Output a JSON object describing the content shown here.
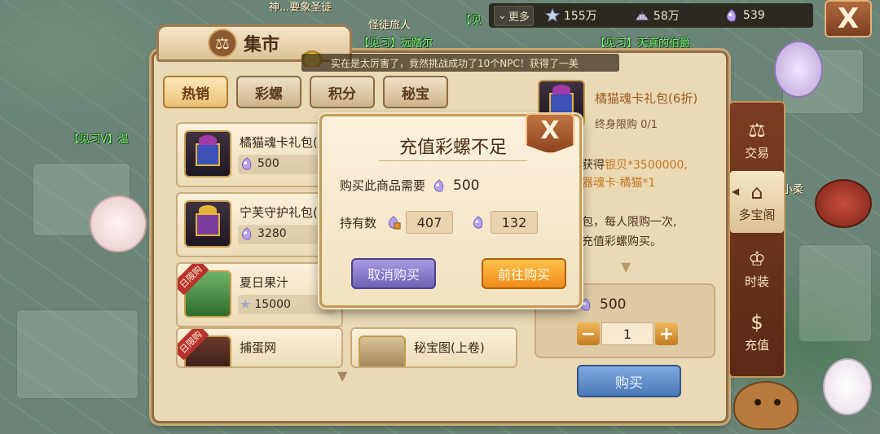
{
  "world": {
    "npc_tags": [
      {
        "text": "神...要象圣徒",
        "cls": "white"
      },
      {
        "text": "怪徒旅人",
        "cls": "white"
      },
      {
        "text": "【见习】远踏尔",
        "cls": ""
      },
      {
        "text": "【见习】天真的伯爵",
        "cls": ""
      },
      {
        "text": "【见习V】温",
        "cls": ""
      },
      {
        "text": "小柔",
        "cls": "white"
      },
      {
        "text": "【见",
        "cls": ""
      }
    ]
  },
  "topbar": {
    "more_label": "更多",
    "resources": [
      {
        "icon": "star-icon",
        "value": "155万"
      },
      {
        "icon": "shell-icon",
        "value": "58万"
      },
      {
        "icon": "gem-icon",
        "value": "539"
      }
    ],
    "close_label": "X"
  },
  "market": {
    "title": "集市",
    "ticker": "实在是太厉害了，竟然挑战成功了10个NPC！获得了一美",
    "tabs": [
      {
        "label": "热销",
        "active": true
      },
      {
        "label": "彩螺",
        "active": false
      },
      {
        "label": "积分",
        "active": false
      },
      {
        "label": "秘宝",
        "active": false
      }
    ],
    "items": [
      {
        "name": "橘猫魂卡礼包(",
        "price": "500",
        "currency": "gem",
        "ribbon": ""
      },
      {
        "name": "宁芙守护礼包(",
        "price": "3280",
        "currency": "gem",
        "ribbon": ""
      },
      {
        "name": "夏日果汁",
        "price": "15000",
        "currency": "star",
        "ribbon": "日限购"
      },
      {
        "name": "捕蛋网",
        "price": "",
        "currency": "star",
        "ribbon": "日限购"
      },
      {
        "name": "秘宝图(上卷)",
        "price": "",
        "currency": "star",
        "ribbon": ""
      }
    ],
    "detail": {
      "name": "橘猫魂卡礼包(6折)",
      "limit": "终身限购 0/1",
      "desc_prefix": "获得",
      "desc_hl1": "银贝*3500000,",
      "desc_hl2": "器魂卡·橘猫*1",
      "desc_line3": "包，每人限购一次,",
      "desc_line4": "充值彩螺购买。",
      "price": "500",
      "quantity": "1",
      "buy_label": "购买"
    },
    "sidenav": [
      {
        "icon": "⚖",
        "label": "交易",
        "active": false
      },
      {
        "icon": "⌂",
        "label": "多宝阁",
        "active": true
      },
      {
        "icon": "♔",
        "label": "时装",
        "active": false
      },
      {
        "icon": "$",
        "label": "充值",
        "active": false
      }
    ]
  },
  "modal": {
    "title": "充值彩螺不足",
    "close_label": "X",
    "need_label": "购买此商品需要",
    "need_value": "500",
    "hold_label": "持有数",
    "hold_value_a": "407",
    "hold_value_b": "132",
    "cancel_label": "取消购买",
    "go_label": "前往购买"
  },
  "colors": {
    "gem_purple": "#a98be6",
    "modal_go": "#f08a1a",
    "modal_cancel": "#6e5fb4",
    "buy_blue": "#4b78b8"
  }
}
